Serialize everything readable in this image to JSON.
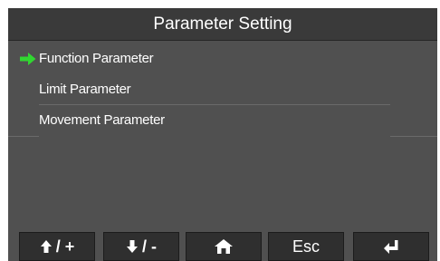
{
  "title": "Parameter Setting",
  "menu": {
    "selected_index": 0,
    "items": [
      {
        "label": "Function Parameter"
      },
      {
        "label": "Limit Parameter"
      },
      {
        "label": "Movement Parameter"
      }
    ]
  },
  "softkeys": {
    "up_plus_symbol": "/ +",
    "down_minus_symbol": "/ -",
    "home_icon": "home-icon",
    "esc_label": "Esc",
    "enter_icon": "enter-return-icon"
  },
  "colors": {
    "screen_bg": "#505050",
    "title_bg": "#3a3a3a",
    "selection_arrow": "#31d631",
    "softkey_bg": "#2f2f2f"
  }
}
